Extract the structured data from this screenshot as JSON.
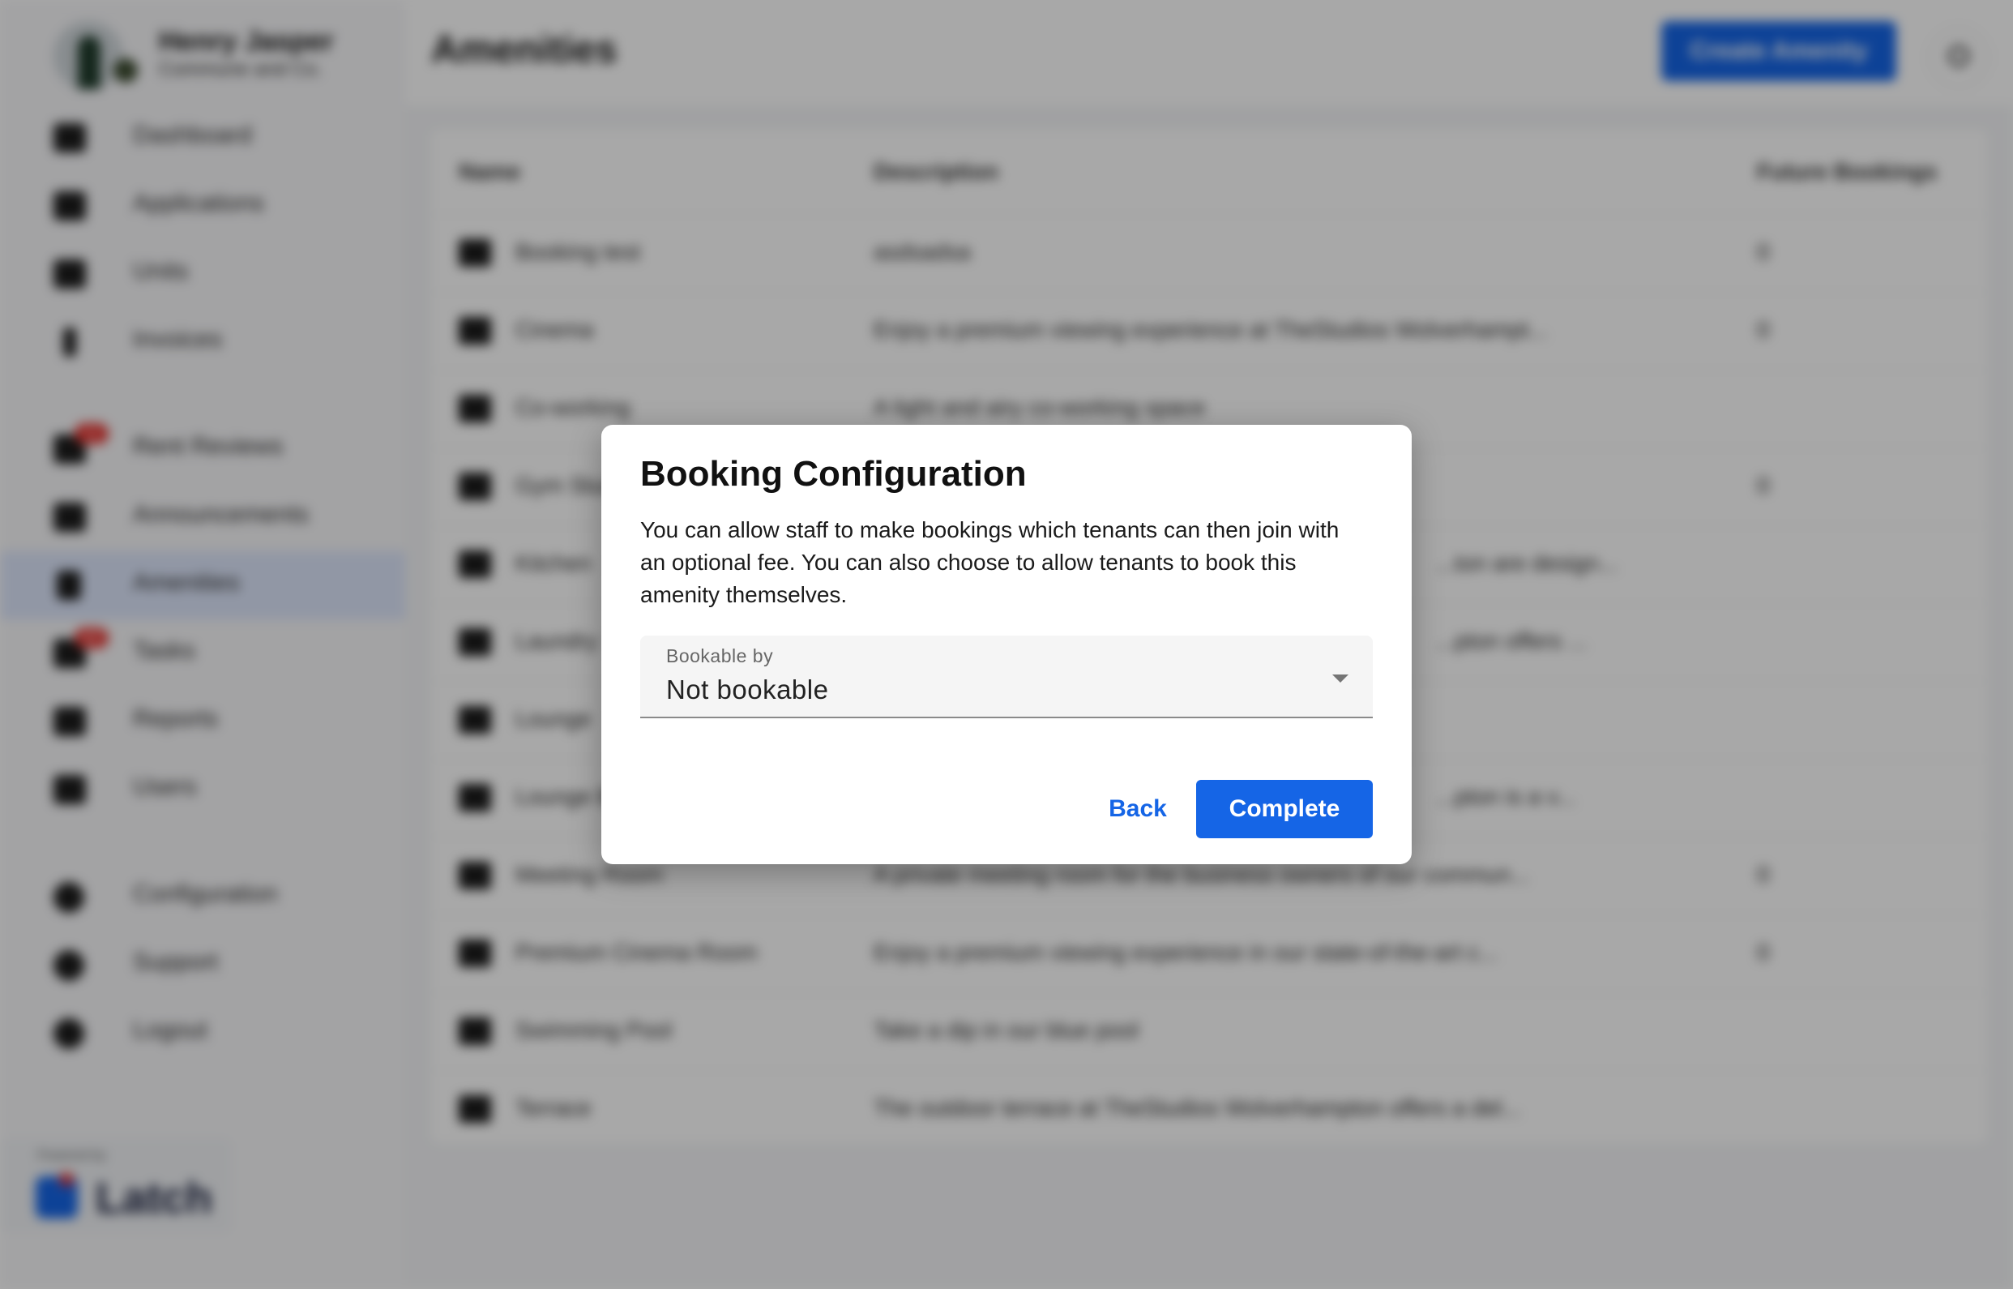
{
  "profile": {
    "name": "Henry Jasper",
    "org": "Commune and Co."
  },
  "sidebar": {
    "items": [
      {
        "label": "Dashboard",
        "icon": "dashboard-icon"
      },
      {
        "label": "Applications",
        "icon": "applications-icon"
      },
      {
        "label": "Units",
        "icon": "units-icon"
      },
      {
        "label": "Invoices",
        "icon": "dollar-icon"
      },
      {
        "label": "Rent Reviews",
        "icon": "rent-reviews-icon",
        "badge": "1"
      },
      {
        "label": "Announcements",
        "icon": "announcements-icon"
      },
      {
        "label": "Amenities",
        "icon": "amenities-icon",
        "active": true
      },
      {
        "label": "Tasks",
        "icon": "tasks-icon",
        "badge": "27"
      },
      {
        "label": "Reports",
        "icon": "reports-icon"
      },
      {
        "label": "Users",
        "icon": "users-icon"
      },
      {
        "label": "Configuration",
        "icon": "gear-icon"
      },
      {
        "label": "Support",
        "icon": "support-icon"
      },
      {
        "label": "Logout",
        "icon": "logout-icon"
      }
    ],
    "powered_by": "Powered by",
    "brand": "Latch"
  },
  "header": {
    "title": "Amenities",
    "create_label": "Create Amenity"
  },
  "table": {
    "columns": [
      "Name",
      "Description",
      "Future Bookings"
    ],
    "rows": [
      {
        "name": "Booking test",
        "description": "asdsadsa",
        "future_bookings": "0"
      },
      {
        "name": "Cinema",
        "description": "Enjoy a premium viewing experience at TheStudios Wolverhampt...",
        "future_bookings": "0"
      },
      {
        "name": "Co-working",
        "description": "A light and airy co-working space",
        "future_bookings": ""
      },
      {
        "name": "Gym Studio",
        "description": "",
        "future_bookings": "0"
      },
      {
        "name": "Kitchen",
        "description": "...ton are design...",
        "future_bookings": ""
      },
      {
        "name": "Laundry",
        "description": "...pton offers ...",
        "future_bookings": ""
      },
      {
        "name": "Lounge",
        "description": "",
        "future_bookings": ""
      },
      {
        "name": "Lounge Bar",
        "description": "...pton is a v...",
        "future_bookings": ""
      },
      {
        "name": "Meeting Room",
        "description": "A private meeting room for the business owners of our commun...",
        "future_bookings": "0"
      },
      {
        "name": "Premium Cinema Room",
        "description": "Enjoy a premium viewing experience in our state-of-the-art c...",
        "future_bookings": "0"
      },
      {
        "name": "Swimming Pool",
        "description": "Take a dip in our blue pool",
        "future_bookings": ""
      },
      {
        "name": "Terrace",
        "description": "The outdoor terrace at TheStudios Wolverhampton offers a del...",
        "future_bookings": ""
      }
    ]
  },
  "dialog": {
    "title": "Booking Configuration",
    "text": "You can allow staff to make bookings which tenants can then join with an optional fee. You can also choose to allow tenants to book this amenity themselves.",
    "select_label": "Bookable by",
    "select_value": "Not bookable",
    "back_label": "Back",
    "complete_label": "Complete"
  },
  "colors": {
    "accent": "#1565e6",
    "badge": "#e53935",
    "overlay": "rgba(0,0,0,0.34)"
  }
}
